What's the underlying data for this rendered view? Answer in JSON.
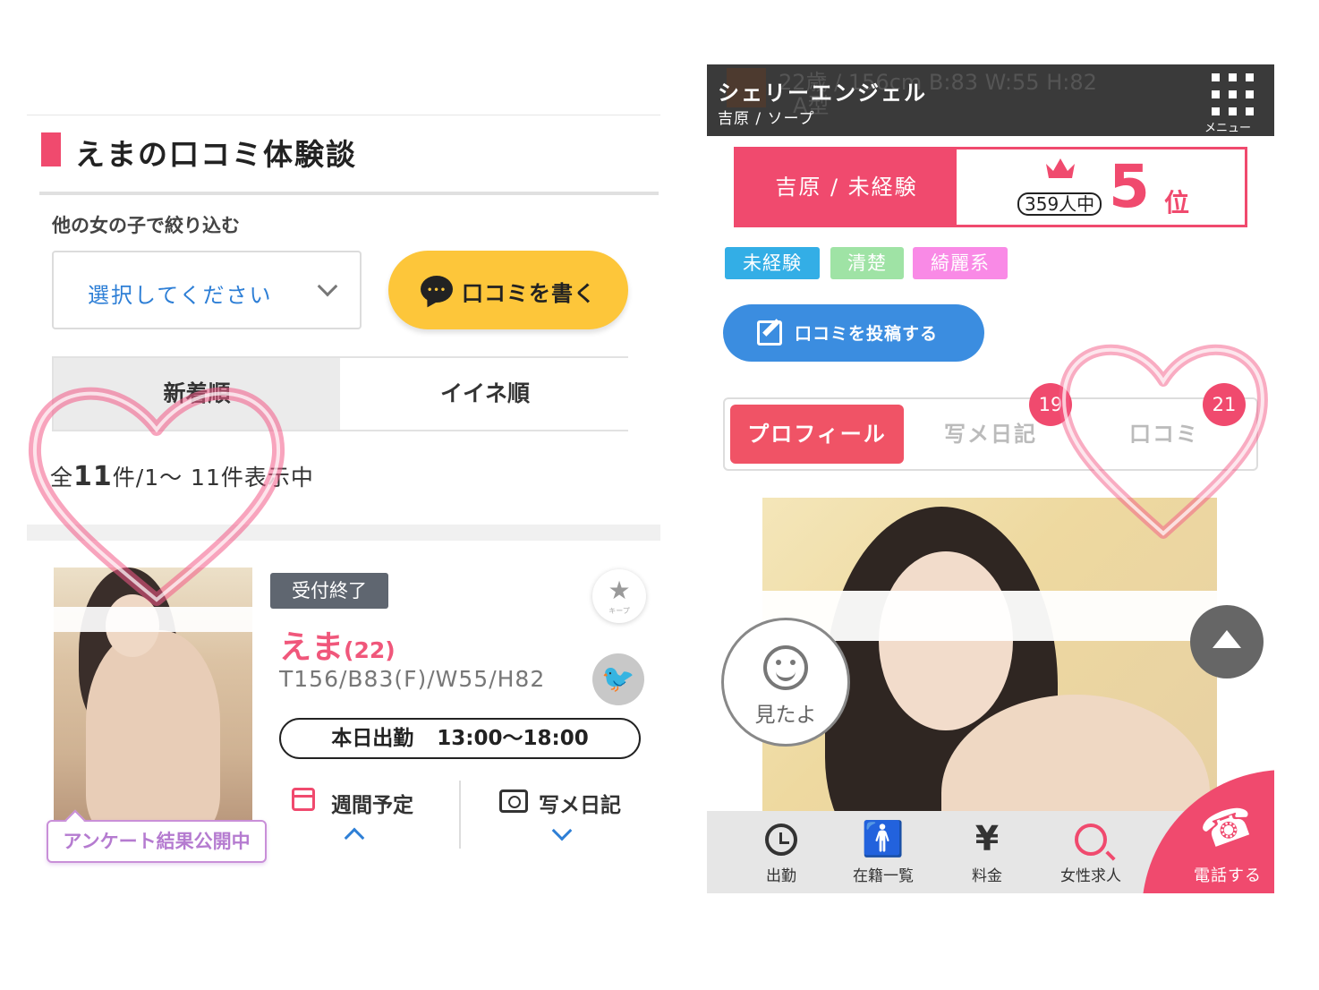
{
  "left": {
    "heading": "えまの口コミ体験談",
    "filter_label": "他の女の子で絞り込む",
    "select_placeholder": "選択してください",
    "write_button": "口コミを書く",
    "tabs": [
      "新着順",
      "イイネ順"
    ],
    "count_prefix": "全",
    "count_total": "11",
    "count_suffix": "件/1～ 11件表示中",
    "card": {
      "status_badge": "受付終了",
      "name": "えま",
      "age": "(22)",
      "stats": "T156/B83(F)/W55/H82",
      "shift_label": "本日出勤",
      "shift_time": "13:00～18:00",
      "survey_badge": "アンケート結果公開中",
      "keep_label": "キープ",
      "weekly_label": "週間予定",
      "photo_diary_label": "写メ日記"
    }
  },
  "right": {
    "ghost_text": "22歳 / 156cm B:83 W:55 H:82",
    "ghost_text2": "A型",
    "shop_name": "シェリーエンジェル",
    "shop_area": "吉原 / ソープ",
    "menu_label": "メニュー",
    "rank_category": "吉原 / 未経験",
    "rank_of": "359人中",
    "rank_number": "5",
    "rank_suffix": "位",
    "tags": [
      "未経験",
      "清楚",
      "綺麗系"
    ],
    "post_button": "口コミを投稿する",
    "profile_tabs": [
      {
        "label": "プロフィール",
        "badge": ""
      },
      {
        "label": "写メ日記",
        "badge": "19"
      },
      {
        "label": "口コミ",
        "badge": "21"
      }
    ],
    "seen_button": "見たよ",
    "bottom_nav": [
      {
        "label": "出勤",
        "icon": "clock-icon"
      },
      {
        "label": "在籍一覧",
        "icon": "person-icon"
      },
      {
        "label": "料金",
        "icon": "yen-icon"
      },
      {
        "label": "女性求人",
        "icon": "search-user-icon"
      }
    ],
    "call_button": "電話する"
  },
  "colors": {
    "accent_pink": "#f04a6e",
    "link_blue": "#2e7fd6",
    "write_yellow": "#fdc63a",
    "post_blue": "#3b8de0"
  }
}
